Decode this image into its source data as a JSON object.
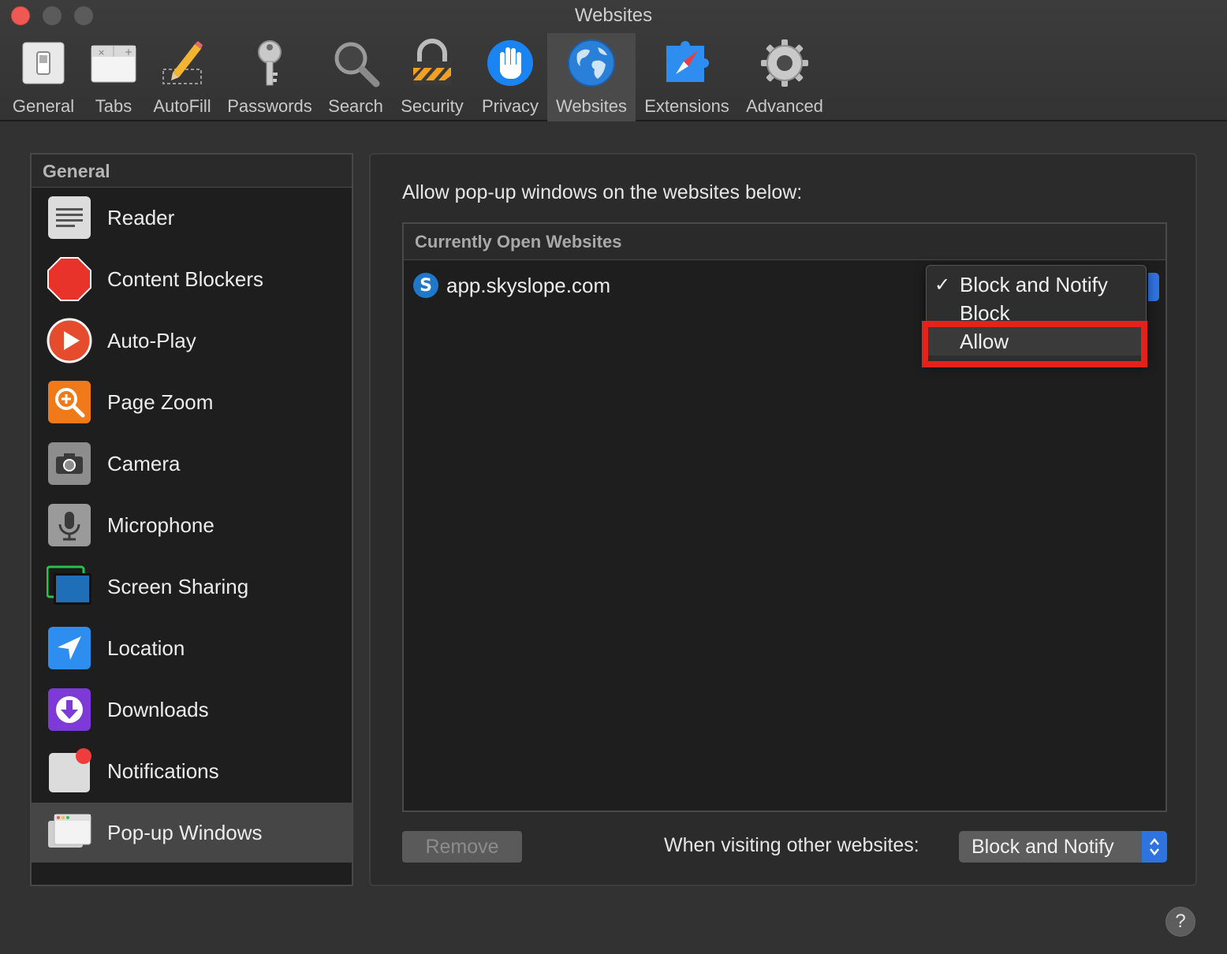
{
  "window": {
    "title": "Websites"
  },
  "toolbar": {
    "items": [
      {
        "label": "General",
        "icon": "general-switch-icon"
      },
      {
        "label": "Tabs",
        "icon": "tabs-icon"
      },
      {
        "label": "AutoFill",
        "icon": "autofill-pencil-icon"
      },
      {
        "label": "Passwords",
        "icon": "key-icon"
      },
      {
        "label": "Search",
        "icon": "magnifier-icon"
      },
      {
        "label": "Security",
        "icon": "padlock-icon"
      },
      {
        "label": "Privacy",
        "icon": "hand-icon"
      },
      {
        "label": "Websites",
        "icon": "globe-icon",
        "active": true
      },
      {
        "label": "Extensions",
        "icon": "puzzle-compass-icon"
      },
      {
        "label": "Advanced",
        "icon": "gear-icon"
      }
    ]
  },
  "sidebar": {
    "header": "General",
    "items": [
      {
        "label": "Reader",
        "icon": "reader-icon"
      },
      {
        "label": "Content Blockers",
        "icon": "stop-sign-icon"
      },
      {
        "label": "Auto-Play",
        "icon": "play-icon"
      },
      {
        "label": "Page Zoom",
        "icon": "zoom-icon"
      },
      {
        "label": "Camera",
        "icon": "camera-icon"
      },
      {
        "label": "Microphone",
        "icon": "microphone-icon"
      },
      {
        "label": "Screen Sharing",
        "icon": "screen-sharing-icon"
      },
      {
        "label": "Location",
        "icon": "location-arrow-icon"
      },
      {
        "label": "Downloads",
        "icon": "download-icon"
      },
      {
        "label": "Notifications",
        "icon": "notification-icon"
      },
      {
        "label": "Pop-up Windows",
        "icon": "popup-window-icon",
        "selected": true
      }
    ]
  },
  "panel": {
    "prompt": "Allow pop-up windows on the websites below:",
    "table_header": "Currently Open Websites",
    "sites": [
      {
        "favicon_letter": "S",
        "name": "app.skyslope.com",
        "setting": "Block and Notify"
      }
    ],
    "menu": {
      "check": "✓",
      "options": [
        "Block and Notify",
        "Block",
        "Allow"
      ],
      "selected": "Block and Notify",
      "highlighted": "Allow"
    },
    "remove_label": "Remove",
    "other_label": "When visiting other websites:",
    "other_value": "Block and Notify"
  },
  "help": {
    "label": "?"
  },
  "colors": {
    "accent": "#2f73e0",
    "highlight_box": "#e3221b",
    "close_button": "#ee5a53"
  }
}
